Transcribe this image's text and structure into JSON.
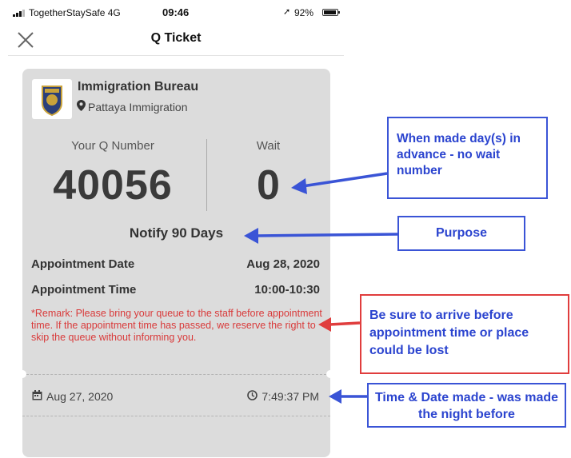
{
  "status_bar": {
    "carrier": "TogetherStaySafe 4G",
    "time": "09:46",
    "battery": "92%"
  },
  "nav": {
    "title": "Q Ticket"
  },
  "ticket": {
    "org_name": "Immigration Bureau",
    "org_location": "Pattaya Immigration",
    "q_label": "Your Q Number",
    "q_number": "40056",
    "wait_label": "Wait",
    "wait_number": "0",
    "purpose": "Notify 90 Days",
    "date_label": "Appointment Date",
    "date_value": "Aug 28, 2020",
    "time_label": "Appointment Time",
    "time_value": "10:00-10:30",
    "remark": "*Remark: Please bring your queue to the staff before appointment time.  If the appointment time has passed, we reserve the right to skip the queue without informing you.",
    "created_date": "Aug 27, 2020",
    "created_time": "7:49:37 PM"
  },
  "annotations": {
    "wait_note": "When made day(s) in advance - no wait number",
    "purpose_note": "Purpose",
    "arrive_note": "Be sure to arrive before appointment time or place could be lost",
    "made_note": "Time & Date made - was made the night before"
  },
  "colors": {
    "card_bg": "#dcdcdc",
    "remark_red": "#d93a3a",
    "annotation_blue": "#2b44cf",
    "annotation_red_border": "#e03d3d"
  }
}
